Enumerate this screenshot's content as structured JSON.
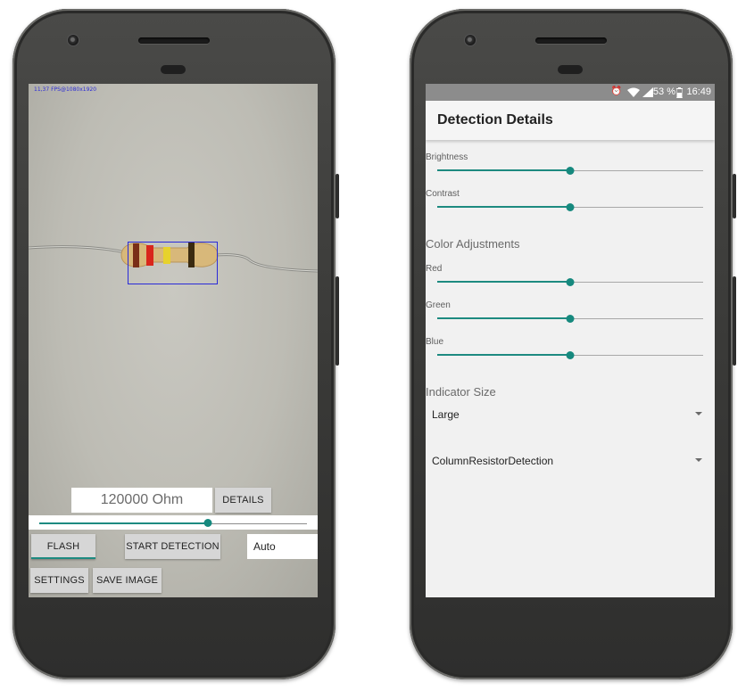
{
  "left_screen": {
    "fps_overlay": "11,37 FPS@1080x1920",
    "resistance_value": "120000 Ohm",
    "details_button": "DETAILS",
    "seekbar_level": 0.63,
    "flash_button": "FLASH",
    "start_detection_button": "START DETECTION",
    "mode_select": "Auto",
    "settings_button": "SETTINGS",
    "save_image_button": "SAVE IMAGE",
    "resistor_band_colors": [
      "#7a2e18",
      "#d9261b",
      "#e7d22c",
      "#3a2a10"
    ]
  },
  "right_screen": {
    "status": {
      "battery": "53 %",
      "time": "16:49",
      "icons": [
        "alarm-icon",
        "wifi-icon",
        "signal-icon",
        "battery-icon"
      ]
    },
    "title": "Detection Details",
    "sliders_top": [
      {
        "label": "Brightness",
        "value": 0.5
      },
      {
        "label": "Contrast",
        "value": 0.5
      }
    ],
    "color_section_title": "Color Adjustments",
    "color_sliders": [
      {
        "label": "Red",
        "value": 0.5
      },
      {
        "label": "Green",
        "value": 0.5
      },
      {
        "label": "Blue",
        "value": 0.5
      }
    ],
    "indicator_section_title": "Indicator Size",
    "indicator_size_value": "Large",
    "detection_method_value": "ColumnResistorDetection"
  },
  "accent_color": "#16897e"
}
